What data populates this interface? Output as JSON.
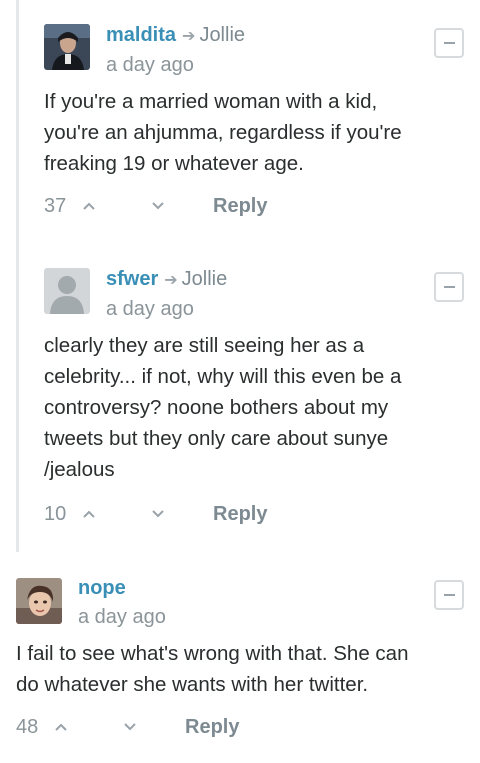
{
  "comments": [
    {
      "author": "maldita",
      "reply_to": "Jollie",
      "time": "a day ago",
      "lines": [
        "If you're a married woman with a kid,",
        "you're an ahjumma, regardless if you're",
        "freaking 19 or whatever age."
      ],
      "votes": "37",
      "reply_label": "Reply"
    },
    {
      "author": "sfwer",
      "reply_to": "Jollie",
      "time": "a day ago",
      "lines": [
        "clearly they are still seeing her as a",
        "celebrity... if not, why will this even be a",
        "controversy? noone bothers about my",
        "tweets but they only care about sunye",
        "/jealous"
      ],
      "votes": "10",
      "reply_label": "Reply"
    },
    {
      "author": "nope",
      "time": "a day ago",
      "lines": [
        "I fail to see what's wrong with that. She can",
        "do whatever she wants with her twitter."
      ],
      "votes": "48",
      "reply_label": "Reply"
    }
  ],
  "icons": {
    "reply_arrow": "arrow-right-icon",
    "upvote": "chevron-up-icon",
    "downvote": "chevron-down-icon",
    "collapse": "minus-icon"
  },
  "colors": {
    "author": "#3a8fb7",
    "meta": "#8a9499",
    "text": "#2a2e2e",
    "thread_line": "#e5e8ea"
  }
}
